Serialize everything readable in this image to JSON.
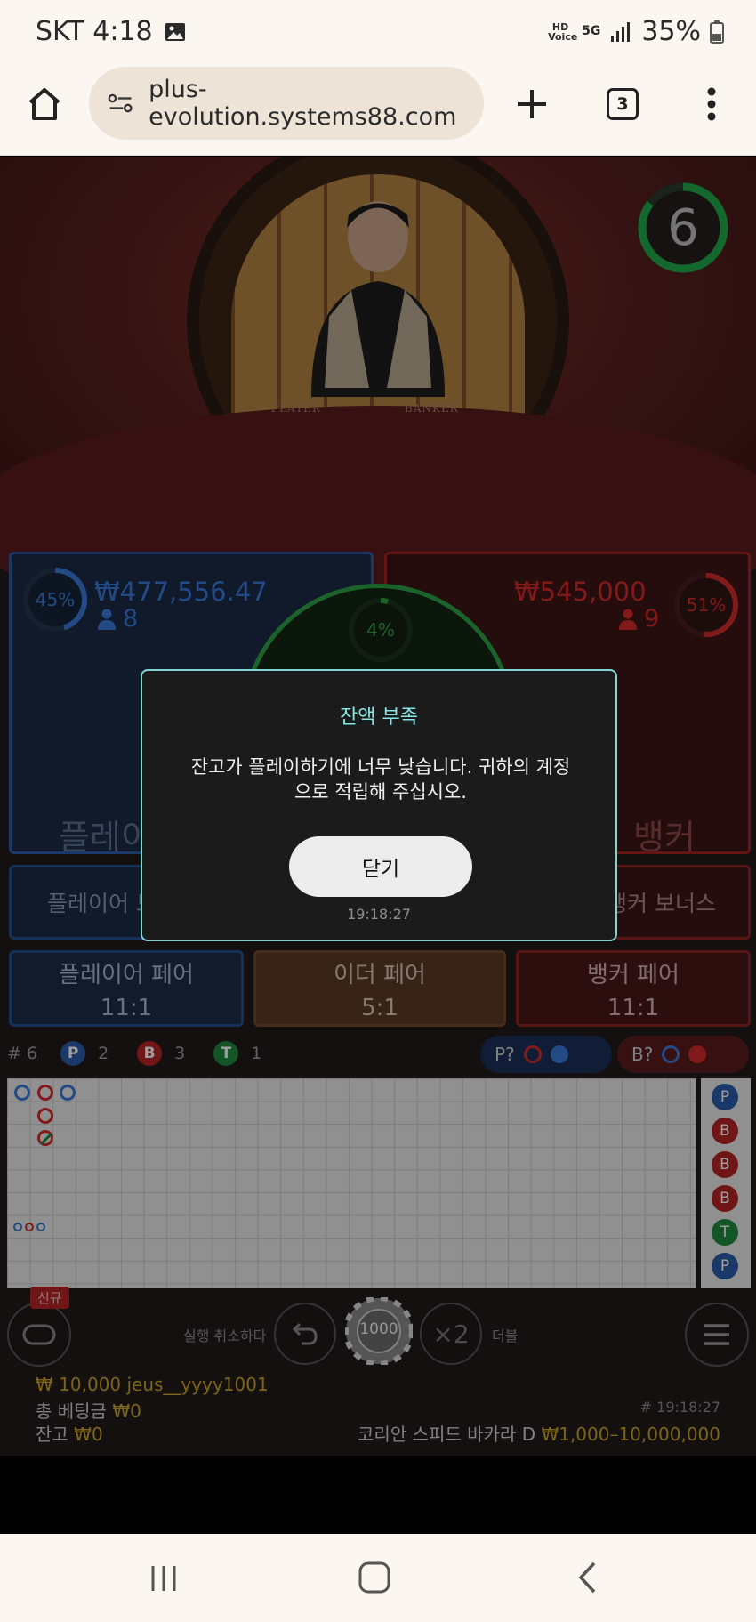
{
  "status_bar": {
    "carrier_time": "SKT 4:18",
    "battery": "35%",
    "hd_voice": "HD Voice",
    "network": "5G"
  },
  "browser": {
    "url": "plus-evolution.systems88.com",
    "tab_count": "3"
  },
  "game": {
    "timer": "6",
    "timer_progress": 0.85,
    "video_labels": {
      "player": "PLAYER",
      "banker": "BANKER"
    },
    "player": {
      "percent": "45%",
      "percent_value": 45,
      "amount": "₩477,556.47",
      "people": "8",
      "label": "플레이어"
    },
    "banker": {
      "percent": "51%",
      "percent_value": 51,
      "amount": "₩545,000",
      "people": "9",
      "label": "뱅커"
    },
    "tie": {
      "percent": "4%",
      "percent_value": 4
    },
    "bonus": {
      "player": "플레이어 보너스",
      "banker": "뱅커 보너스"
    },
    "pairs": [
      {
        "label": "플레이어 페어",
        "odds": "11:1"
      },
      {
        "label": "이더 페어",
        "odds": "5:1"
      },
      {
        "label": "뱅커 페어",
        "odds": "11:1"
      }
    ],
    "stats": {
      "rounds": "# 6",
      "p": "P",
      "p_count": "2",
      "b": "B",
      "b_count": "3",
      "t": "T",
      "t_count": "1"
    },
    "ask": {
      "player": "P?",
      "banker": "B?"
    },
    "side_road": [
      "P",
      "B",
      "B",
      "B",
      "T",
      "P"
    ],
    "controls": {
      "new_badge": "신규",
      "undo_label": "실행 취소하다",
      "chip_value": "1000",
      "double_symbol": "×2",
      "double_label": "더블"
    },
    "info": {
      "user_line_currency": "₩",
      "user_line": "10,000 jeus__yyyy1001",
      "total_bet_label": "총 베팅금",
      "total_bet_value": "₩0",
      "balance_label": "잔고",
      "balance_value": "₩0",
      "round_time": "# 19:18:27",
      "table_name": "코리안 스피드 바카라 D",
      "table_limits": "₩1,000–10,000,000"
    }
  },
  "dialog": {
    "title": "잔액 부족",
    "message_line1": "잔고가 플레이하기에 너무 낮습니다. 귀하의 계정",
    "message_line2": "으로 적립해 주십시오.",
    "close_label": "닫기",
    "time": "19:18:27"
  },
  "colors": {
    "player_blue": "#3a78d8",
    "banker_red": "#d42a2a",
    "tie_green": "#2da146",
    "dialog_accent": "#7fd6d0",
    "gold": "#c9a227"
  }
}
